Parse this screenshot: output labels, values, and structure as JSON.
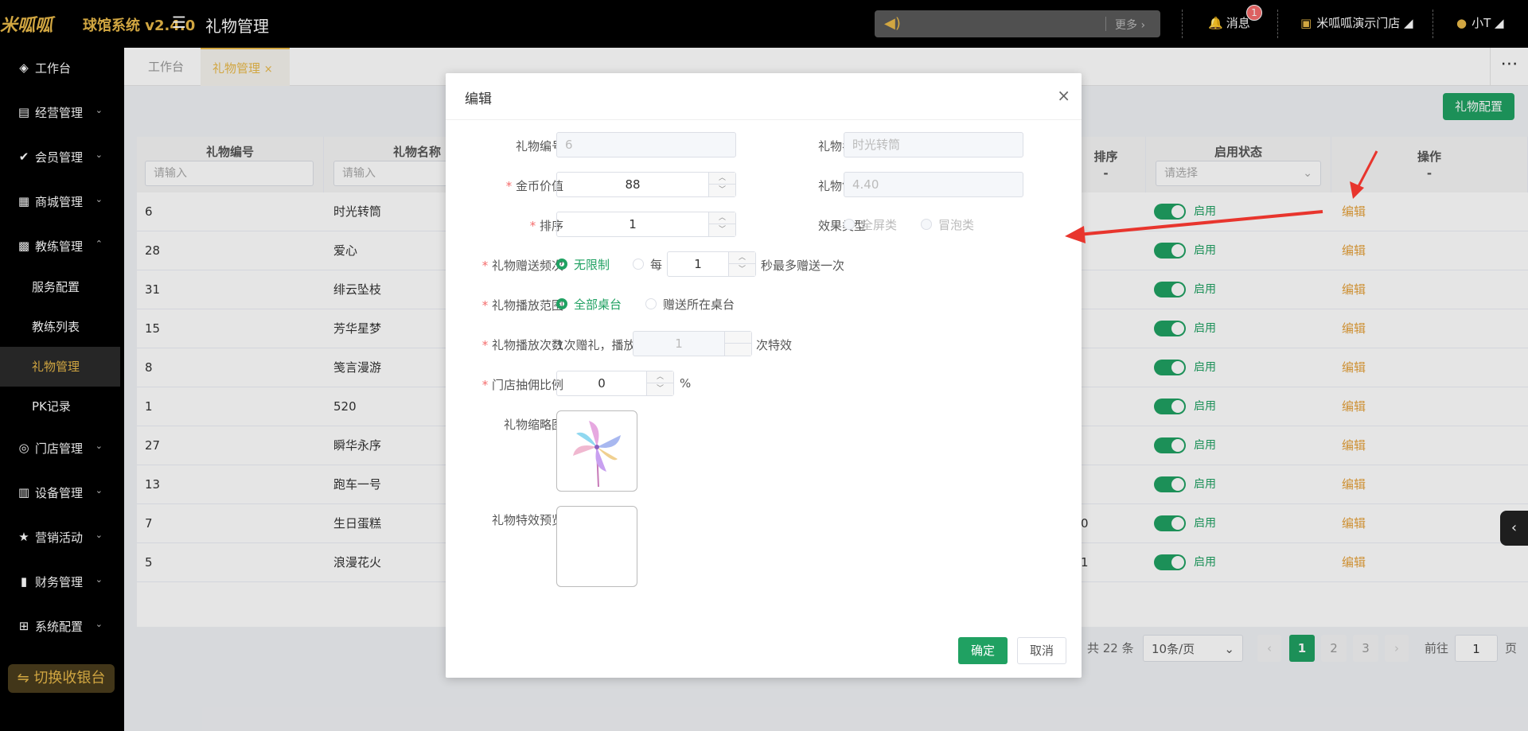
{
  "header": {
    "logo": "米呱呱",
    "brand": "球馆系统 v2.4.0",
    "page_title": "礼物管理",
    "notice_more": "更多 ›",
    "messages_label": "消息",
    "messages_count": "1",
    "store_name": "米呱呱演示门店",
    "user_name": "小T"
  },
  "sidebar": {
    "items": [
      {
        "label": "工作台",
        "icon": "cube-icon"
      },
      {
        "label": "经营管理",
        "icon": "chart-icon"
      },
      {
        "label": "会员管理",
        "icon": "check-icon"
      },
      {
        "label": "商城管理",
        "icon": "shop-icon"
      },
      {
        "label": "教练管理",
        "icon": "coach-icon"
      },
      {
        "label": "服务配置"
      },
      {
        "label": "教练列表"
      },
      {
        "label": "礼物管理"
      },
      {
        "label": "PK记录"
      },
      {
        "label": "门店管理",
        "icon": "coins-icon"
      },
      {
        "label": "设备管理",
        "icon": "device-icon"
      },
      {
        "label": "营销活动",
        "icon": "star-icon"
      },
      {
        "label": "财务管理",
        "icon": "finance-icon"
      },
      {
        "label": "系统配置",
        "icon": "grid-icon"
      }
    ],
    "switch_label": "⇋ 切换收银台"
  },
  "tabs": [
    {
      "label": "工作台"
    },
    {
      "label": "礼物管理",
      "close": "×"
    }
  ],
  "toolbar": {
    "config_button": "礼物配置"
  },
  "table": {
    "col_id": "礼物编号",
    "col_name": "礼物名称",
    "col_sort": "排序",
    "col_sort_sub": "-",
    "col_status": "启用状态",
    "col_action": "操作",
    "col_action_sub": "-",
    "input_placeholder": "请输入",
    "select_placeholder": "请选择",
    "rows": [
      {
        "id": "6",
        "name": "时光转筒",
        "sort": "",
        "status": "启用",
        "action": "编辑"
      },
      {
        "id": "28",
        "name": "爱心",
        "sort": "",
        "status": "启用",
        "action": "编辑"
      },
      {
        "id": "31",
        "name": "绯云坠枝",
        "sort": "",
        "status": "启用",
        "action": "编辑"
      },
      {
        "id": "15",
        "name": "芳华星梦",
        "sort": "",
        "status": "启用",
        "action": "编辑"
      },
      {
        "id": "8",
        "name": "笺言漫游",
        "sort": "",
        "status": "启用",
        "action": "编辑"
      },
      {
        "id": "1",
        "name": "520",
        "sort": "",
        "status": "启用",
        "action": "编辑"
      },
      {
        "id": "27",
        "name": "瞬华永序",
        "sort": "",
        "status": "启用",
        "action": "编辑"
      },
      {
        "id": "13",
        "name": "跑车一号",
        "sort": "",
        "status": "启用",
        "action": "编辑"
      },
      {
        "id": "7",
        "name": "生日蛋糕",
        "sort": "0",
        "status": "启用",
        "action": "编辑"
      },
      {
        "id": "5",
        "name": "浪漫花火",
        "sort": "1",
        "status": "启用",
        "action": "编辑"
      }
    ]
  },
  "pagination": {
    "total": "共 22 条",
    "page_size": "10条/页",
    "pages": [
      "1",
      "2",
      "3"
    ],
    "prev": "‹",
    "next": "›",
    "goto_label": "前往",
    "goto_value": "1",
    "page_suffix": "页"
  },
  "dialog": {
    "title": "编辑",
    "close": "×",
    "gift_id_label": "礼物编号",
    "gift_id_value": "6",
    "gift_name_label": "礼物名称",
    "gift_name_value": "时光转筒",
    "coin_label": "金币价值",
    "coin_value": "88",
    "price_label": "礼物售价",
    "price_value": "4.40",
    "sort_label": "排序",
    "sort_value": "1",
    "effect_label": "效果类型",
    "effect_opt1": "全屏类",
    "effect_opt2": "冒泡类",
    "freq_label": "礼物赠送频次",
    "freq_opt1": "无限制",
    "freq_opt2": "每",
    "freq_value": "1",
    "freq_suffix": "秒最多赠送一次",
    "range_label": "礼物播放范围",
    "range_opt1": "全部桌台",
    "range_opt2": "赠送所在桌台",
    "times_label": "礼物播放次数",
    "times_prefix": "1次赠礼，播放",
    "times_value": "1",
    "times_suffix": "次特效",
    "commission_label": "门店抽佣比例",
    "commission_value": "0",
    "commission_suffix": "%",
    "thumb_label": "礼物缩略图",
    "preview_label": "礼物特效预览",
    "ok": "确定",
    "cancel": "取消"
  },
  "colors": {
    "accent": "#e9b949",
    "primary": "#20a162",
    "edit": "#e6a23c",
    "annotation": "#e8352d"
  }
}
